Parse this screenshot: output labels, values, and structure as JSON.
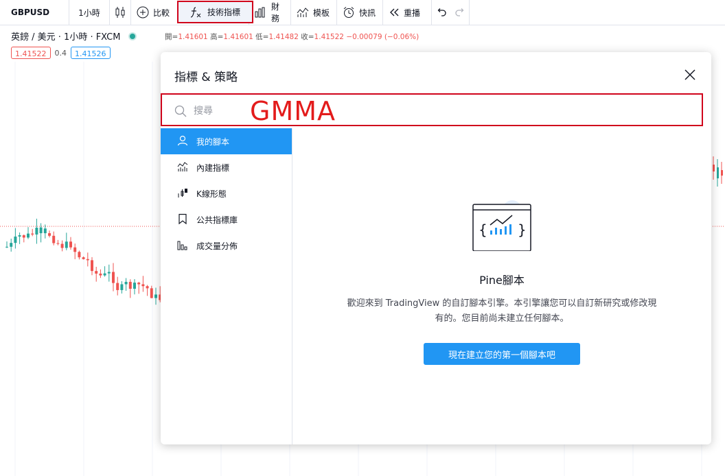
{
  "toolbar": {
    "symbol": "GBPUSD",
    "interval": "1小時",
    "compare_label": "比較",
    "indicators_label": "技術指標",
    "financials_label": "財務",
    "templates_label": "模板",
    "alerts_label": "快訊",
    "replay_label": "重播"
  },
  "legend": {
    "title": "英鎊 / 美元 · 1小時 · FXCM",
    "ohlc": [
      {
        "k": "開",
        "v": "1.41601"
      },
      {
        "k": "高",
        "v": "1.41601"
      },
      {
        "k": "低",
        "v": "1.41482"
      },
      {
        "k": "收",
        "v": "1.41522"
      }
    ],
    "change": "−0.00079 (−0.06%)",
    "sell_price": "1.41522",
    "spread": "0.4",
    "buy_price": "1.41526"
  },
  "dialog": {
    "title": "指標 & 策略",
    "search_placeholder": "搜尋",
    "annotation": "GMMA",
    "sidebar": [
      {
        "label": "我的腳本",
        "icon": "user-icon",
        "active": true
      },
      {
        "label": "內建指標",
        "icon": "chart-icon",
        "active": false
      },
      {
        "label": "K線形態",
        "icon": "candles-icon",
        "active": false
      },
      {
        "label": "公共指標庫",
        "icon": "bookmark-icon",
        "active": false
      },
      {
        "label": "成交量分佈",
        "icon": "volume-profile-icon",
        "active": false
      }
    ],
    "pine": {
      "title": "Pine腳本",
      "desc_line1": "歡迎來到 TradingView 的自訂腳本引擎。本引擎讓您可以自訂新研究或修改現",
      "desc_line2": "有的。您目前尚未建立任何腳本。",
      "button": "現在建立您的第一個腳本吧"
    }
  },
  "colors": {
    "accent": "#2196f3",
    "up": "#26a69a",
    "down": "#ef5350",
    "highlight": "#d0021b"
  }
}
